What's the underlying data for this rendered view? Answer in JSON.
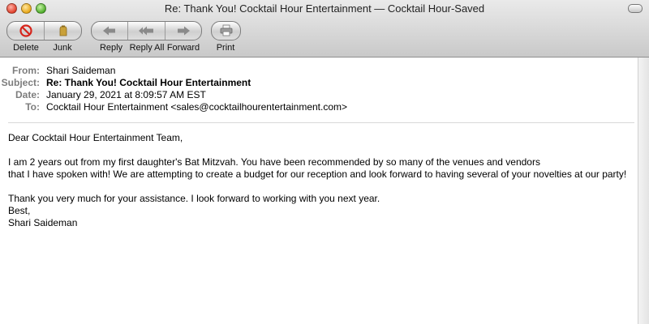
{
  "window": {
    "title": "Re: Thank You! Cocktail Hour Entertainment — Cocktail Hour-Saved"
  },
  "toolbar": {
    "delete_label": "Delete",
    "junk_label": "Junk",
    "reply_label": "Reply",
    "reply_all_label": "Reply All",
    "forward_label": "Forward",
    "print_label": "Print"
  },
  "icons": {
    "delete": "no-entry-icon",
    "junk": "junk-bag-icon",
    "reply": "reply-arrow-icon",
    "reply_all": "reply-all-arrow-icon",
    "forward": "forward-arrow-icon",
    "print": "printer-icon"
  },
  "colors": {
    "delete_icon": "#d6241b",
    "junk_icon": "#c9a13a",
    "header_label": "#7d7d7d"
  },
  "headers": [
    {
      "key": "From:",
      "value": "Shari Saideman"
    },
    {
      "key": "Subject:",
      "value": "Re: Thank You! Cocktail Hour Entertainment"
    },
    {
      "key": "Date:",
      "value": "January 29, 2021 at 8:09:57 AM EST"
    },
    {
      "key": "To:",
      "value": "Cocktail Hour Entertainment <sales@cocktailhourentertainment.com>"
    }
  ],
  "message": {
    "greeting": "Dear Cocktail Hour Entertainment Team,",
    "para1_line1": "I am 2 years out from my first daughter's Bat Mitzvah.  You have been recommended by so many of the venues and vendors",
    "para1_line2": "that I have spoken with!  We are attempting to create a budget for our reception and look forward to having several of your novelties at our party!",
    "para2": "Thank you very much for your assistance.  I look forward to working with you next year.",
    "closing": "Best,",
    "signature": "Shari Saideman"
  }
}
